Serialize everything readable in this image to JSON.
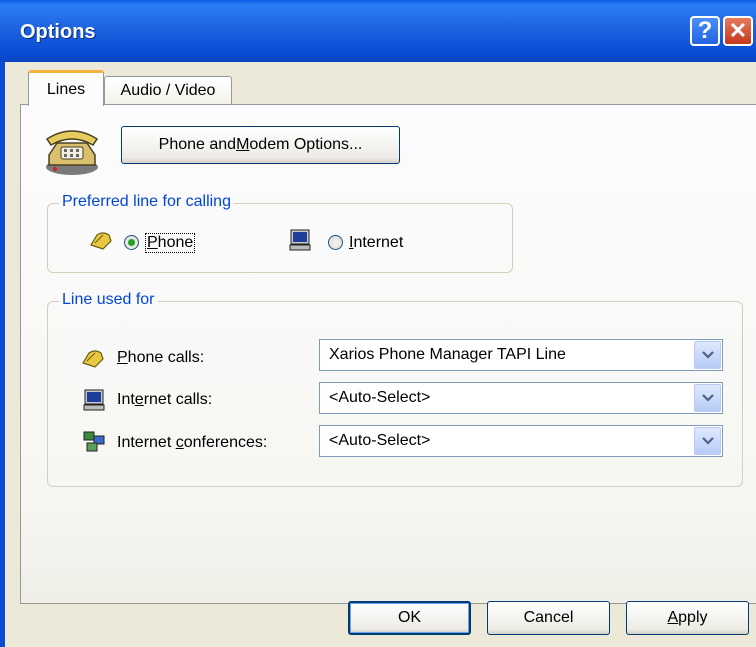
{
  "window": {
    "title": "Options"
  },
  "titlebar": {
    "help_glyph": "?",
    "close_glyph": "✕"
  },
  "tabs": [
    {
      "label": "Lines",
      "active": true
    },
    {
      "label": "Audio / Video",
      "active": false
    }
  ],
  "lines_tab": {
    "phone_modem_button": {
      "pre": "Phone and ",
      "accel": "M",
      "post": "odem Options..."
    },
    "preferred_group": {
      "label": "Preferred line for calling",
      "phone": {
        "accel": "P",
        "rest": "hone",
        "selected": true
      },
      "internet": {
        "accel": "I",
        "rest": "nternet",
        "selected": false
      }
    },
    "line_used_group": {
      "label": "Line used for",
      "rows": [
        {
          "pre": "",
          "accel": "P",
          "post": "hone calls:",
          "value": "Xarios Phone Manager TAPI Line",
          "icon": "phone-icon"
        },
        {
          "pre": "Int",
          "accel": "e",
          "post": "rnet calls:",
          "value": "<Auto-Select>",
          "icon": "computer-icon"
        },
        {
          "pre": "Internet ",
          "accel": "c",
          "post": "onferences:",
          "value": "<Auto-Select>",
          "icon": "network-icon"
        }
      ]
    }
  },
  "footer": {
    "ok": "OK",
    "cancel": "Cancel",
    "apply": {
      "accel": "A",
      "rest": "pply"
    }
  },
  "colors": {
    "titlebar": "#0b4fd6",
    "group_label": "#0046d5",
    "radio_dot": "#21a121",
    "dialog_bg": "#ece9d8"
  }
}
